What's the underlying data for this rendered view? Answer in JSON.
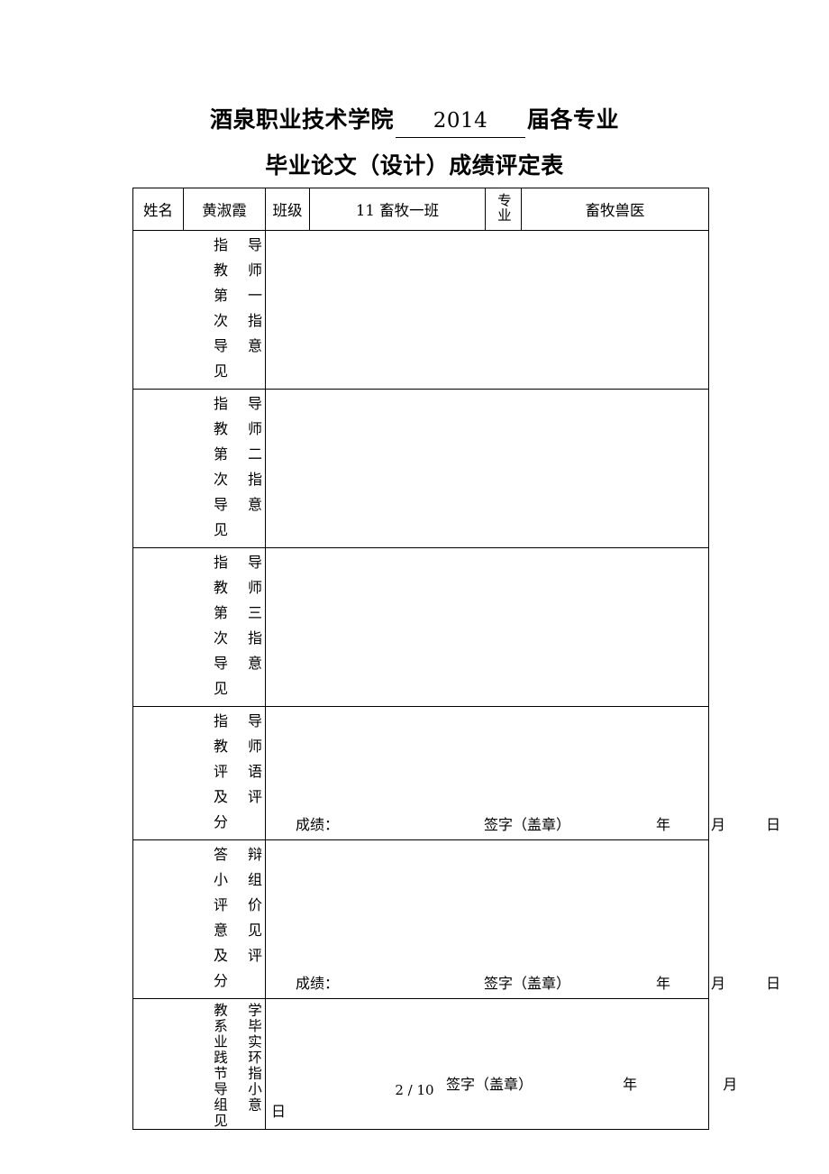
{
  "document": {
    "title_prefix": "酒泉职业技术学院",
    "title_year": "2014",
    "title_suffix": "届各专业",
    "subtitle": "毕业论文（设计）成绩评定表"
  },
  "header_row": {
    "name_label": "姓名",
    "name_value": "黄淑霞",
    "class_label": "班级",
    "class_value": "11 畜牧一班",
    "major_label": "专业",
    "major_value": "畜牧兽医"
  },
  "sections": [
    {
      "label_right": "导师一指意",
      "label_left": "指教第次导见",
      "full_label": "指导教师第一次指导意见",
      "content": ""
    },
    {
      "label_right": "导师二指意",
      "label_left": "指教第次导见",
      "full_label": "指导教师第二次指导意见",
      "content": ""
    },
    {
      "label_right": "导师三指意",
      "label_left": "指教第次导见",
      "full_label": "指导教师第三次指导意见",
      "content": ""
    },
    {
      "label_right": "导师语评",
      "label_left": "指教评及分",
      "full_label": "指导教师评语及评分",
      "content": ""
    },
    {
      "label_right": "辩组价见评",
      "label_left": "答小评意及分",
      "full_label": "答辩小组评价意见及评分",
      "content": ""
    },
    {
      "label_right": "学毕实环指小意",
      "label_left": "教系业践节导组见",
      "full_label": "教学系毕业实践环节指导小组意见",
      "content": ""
    }
  ],
  "signature_line": {
    "score": "成绩：",
    "sign": "签字（盖章）",
    "year": "年",
    "month": "月",
    "day": "日"
  },
  "footer": {
    "page_number": "2 / 10"
  }
}
